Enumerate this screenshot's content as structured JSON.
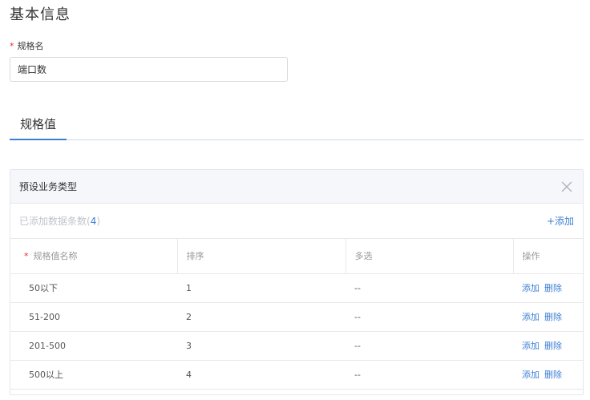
{
  "section": {
    "title": "基本信息"
  },
  "spec_name": {
    "required_mark": "*",
    "label": "规格名",
    "value": "端口数"
  },
  "tabs": [
    {
      "label": "规格值",
      "active": true
    }
  ],
  "panel": {
    "title": "预设业务类型",
    "count_prefix": "已添加数据条数(",
    "count": "4",
    "count_suffix": ")",
    "add_label": "+添加",
    "columns": [
      {
        "label": "规格值名称",
        "required": true
      },
      {
        "label": "排序",
        "required": false
      },
      {
        "label": "多选",
        "required": false
      },
      {
        "label": "操作",
        "required": false
      }
    ],
    "required_mark": "*",
    "rows": [
      {
        "name": "50以下",
        "order": "1",
        "multi": "--"
      },
      {
        "name": "51-200",
        "order": "2",
        "multi": "--"
      },
      {
        "name": "201-500",
        "order": "3",
        "multi": "--"
      },
      {
        "name": "500以上",
        "order": "4",
        "multi": "--"
      }
    ],
    "row_actions": {
      "add": "添加",
      "delete": "删除"
    }
  },
  "colors": {
    "accent": "#3d7fd6",
    "required": "#f5222d",
    "header_bg": "#f5f7fa"
  },
  "icons": {
    "close": "close-icon"
  }
}
